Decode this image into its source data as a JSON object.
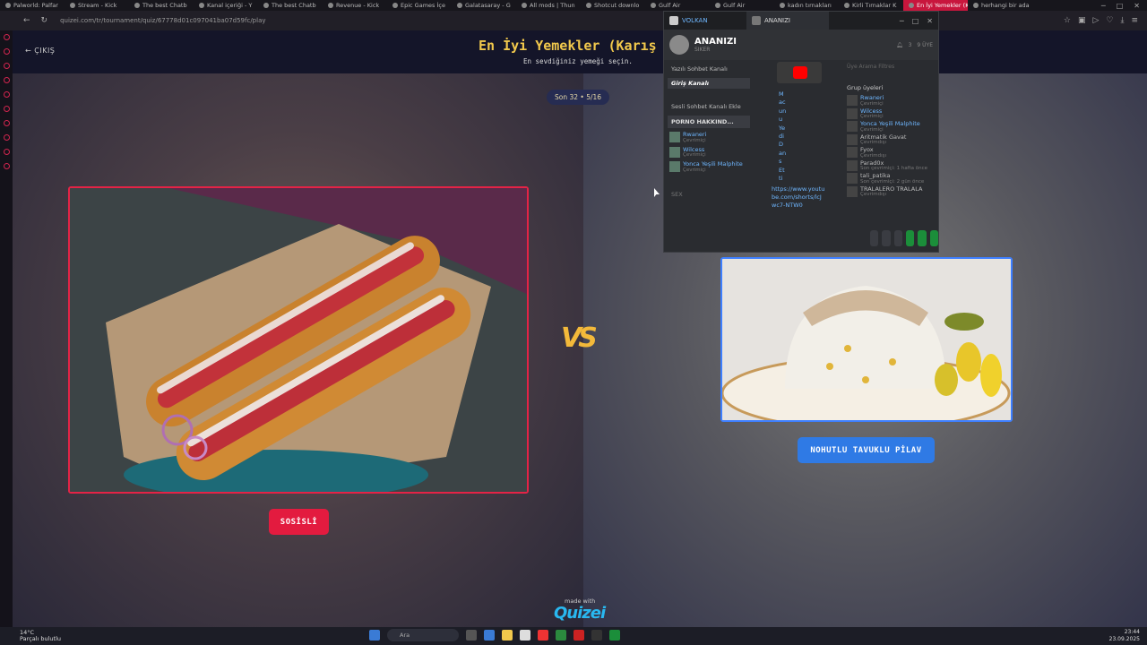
{
  "browser": {
    "tabs": [
      "Palworld: Palfar",
      "Stream - Kick",
      "The best Chatb",
      "Kanal içeriği - Y",
      "The best Chatb",
      "Revenue - Kick",
      "Epic Games İçe",
      "Galatasaray - G",
      "All mods | Thun",
      "Shotcut downlo",
      "Gulf Air",
      "Gulf Air",
      "kadın tırnakları",
      "Kirli Tırnaklar K",
      "En İyi Yemekler (Karışık)",
      "herhangi bir ada"
    ],
    "active_tab": "En İyi Yemekler (Karışık)",
    "url": "quizei.com/tr/tournament/quiz/67778d01c097041ba07d59fc/play"
  },
  "quiz": {
    "exit_label": "ÇIKIŞ",
    "title": "En İyi Yemekler (Karış",
    "subtitle": "En sevdiğiniz yemeği seçin.",
    "progress": "Son 32 • 5/16",
    "vs_label": "VS",
    "left_option": "SOSİSLİ",
    "right_option": "NOHUTLU TAVUKLU PİLAV",
    "made_with": "made with",
    "logo": "Quizei"
  },
  "overlay": {
    "tabs": [
      "VOLKAN",
      "ANANIZI"
    ],
    "server_name": "ANANIZI",
    "server_sub": "SIKER",
    "member_count": "9 ÜYE",
    "online_count": "3",
    "text_channels_label": "Yazılı Sohbet Kanalı",
    "selected_channel": "Giriş Kanalı",
    "voice_label": "Sesli Sohbet Kanalı Ekle",
    "voice_channel": "PORNO HAKKIND...",
    "voice_members": [
      {
        "name": "Rwaneri",
        "status": "Çevrimiçi"
      },
      {
        "name": "Wilcess",
        "status": "Çevrimiçi"
      },
      {
        "name": "Yonca Yeşili Malphite",
        "status": "Çevrimiçi"
      }
    ],
    "sex_label": "SEX",
    "chat_words": "M ac un u Ye di D an s Et ti",
    "chat_link": "https://www.youtube.com/shorts/lcJwc7-NTW0",
    "search_placeholder": "Üye Arama Filtres",
    "group_label": "Grup üyeleri",
    "group_members": [
      {
        "name": "Rwaneri",
        "status": "Çevrimiçi",
        "online": true
      },
      {
        "name": "Wilcess",
        "status": "Çevrimiçi",
        "online": true
      },
      {
        "name": "Yonca Yeşili Malphite",
        "status": "Çevrimiçi",
        "online": true
      },
      {
        "name": "Aritmatik Gavat",
        "status": "Çevrimdışı",
        "online": false
      },
      {
        "name": "Fyox",
        "status": "Çevrimdışı",
        "online": false
      },
      {
        "name": "Parad0x",
        "status": "Son çevrimiçi: 1 hafta önce",
        "online": false
      },
      {
        "name": "tali_patika",
        "status": "Son çevrimiçi: 2 gün önce",
        "online": false
      },
      {
        "name": "TRALALERO TRALALA",
        "status": "Çevrimdışı",
        "online": false
      }
    ]
  },
  "taskbar": {
    "temp": "14°C",
    "weather": "Parçalı bulutlu",
    "search": "Ara",
    "time": "23:44",
    "date": "23.09.2025"
  }
}
